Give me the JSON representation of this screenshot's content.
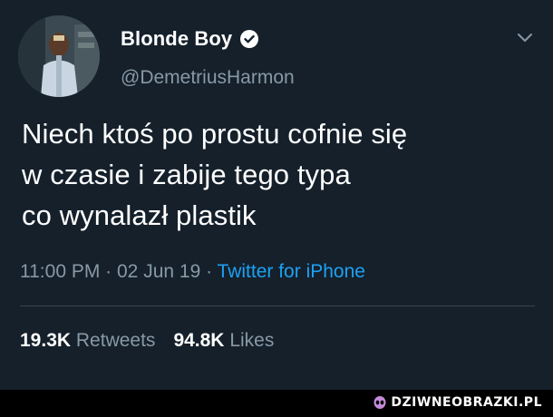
{
  "tweet": {
    "display_name": "Blonde Boy",
    "handle": "@DemetriusHarmon",
    "text_lines": [
      "Niech ktoś po prostu cofnie się",
      "w czasie i zabije tego typa",
      "co wynalazł plastik"
    ],
    "time": "11:00 PM",
    "separator": " · ",
    "date": "02 Jun 19",
    "source": "Twitter for iPhone",
    "retweets_count": "19.3K",
    "retweets_label": "Retweets",
    "likes_count": "94.8K",
    "likes_label": "Likes"
  },
  "icons": {
    "verified": "verified-badge-icon",
    "chevron": "chevron-down-icon",
    "watermark": "alien-icon"
  },
  "colors": {
    "background": "#15202b",
    "secondary_text": "#8899a6",
    "link": "#1da1f2",
    "divider": "#38444d"
  },
  "watermark": {
    "text": "DZIWNEOBRAZKI.PL"
  }
}
